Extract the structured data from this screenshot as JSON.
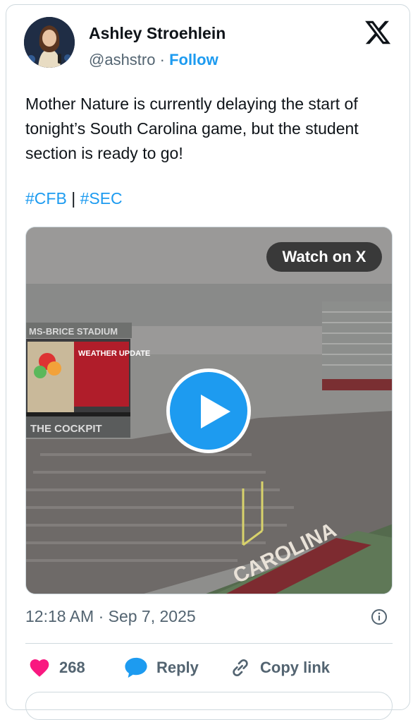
{
  "author": {
    "name": "Ashley Stroehlein",
    "handle": "@ashstro",
    "separator": "·",
    "follow_label": "Follow"
  },
  "tweet": {
    "text": "Mother Nature is currently delaying the start of tonight’s South Carolina game, but the student section is ready to go!",
    "hashtags": [
      "#CFB",
      "#SEC"
    ],
    "hashtag_separator": "|"
  },
  "media": {
    "watch_label": "Watch on X",
    "stadium_sign": "MS-BRICE STADIUM",
    "scoreboard_title": "WEATHER UPDATE",
    "cockpit_sign": "THE COCKPIT",
    "endzone_text": "CAROLINA"
  },
  "meta": {
    "timestamp": "12:18 AM · Sep 7, 2025"
  },
  "actions": {
    "like_count": "268",
    "reply_label": "Reply",
    "copy_label": "Copy link"
  },
  "colors": {
    "accent": "#1d9bf0",
    "like": "#f91880",
    "text": "#0f1419",
    "muted": "#536471",
    "border": "#cfd9de"
  },
  "icons": [
    "x-logo-icon",
    "info-icon",
    "heart-icon",
    "reply-bubble-icon",
    "link-icon",
    "play-icon"
  ]
}
